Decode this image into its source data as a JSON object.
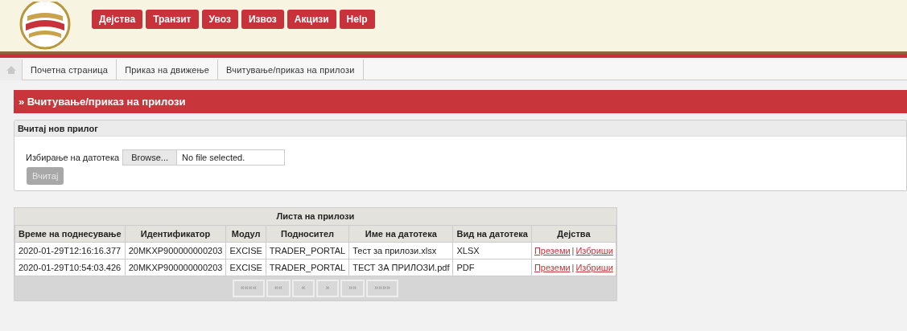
{
  "menu": [
    {
      "label": "Дејства"
    },
    {
      "label": "Транзит"
    },
    {
      "label": "Увоз"
    },
    {
      "label": "Извоз"
    },
    {
      "label": "Акцизи"
    },
    {
      "label": "Help"
    }
  ],
  "breadcrumb": [
    "Почетна страница",
    "Приказ на движење",
    "Вчитување/приказ на прилози"
  ],
  "page_title": "» Вчитување/приказ на прилози",
  "upload": {
    "title": "Вчитај нов прилог",
    "label": "Избирање на датотека",
    "browse_button": "Browse...",
    "file_status": "No file selected.",
    "submit_button": {
      "label": "Вчитај",
      "disabled": true
    }
  },
  "table": {
    "title": "Листа на прилози",
    "columns": [
      "Време на поднесување",
      "Идентификатор",
      "Модул",
      "Подносител",
      "Име на датотека",
      "Вид на датотека",
      "Дејства"
    ],
    "rows": [
      {
        "cells": [
          "2020-01-29T12:16:16.377",
          "20MKXP900000000203",
          "EXCISE",
          "TRADER_PORTAL",
          "Тест за прилози.xlsx",
          "XLSX"
        ],
        "links": [
          "Преземи",
          "Избриши"
        ]
      },
      {
        "cells": [
          "2020-01-29T10:54:03.426",
          "20MKXP900000000203",
          "EXCISE",
          "TRADER_PORTAL",
          "ТЕСТ ЗА ПРИЛОЗИ.pdf",
          "PDF"
        ],
        "links": [
          "Преземи",
          "Избриши"
        ]
      }
    ],
    "link_separator": "|",
    "pager": [
      {
        "label": "««««",
        "disabled": true
      },
      {
        "label": "««",
        "disabled": true
      },
      {
        "label": "«",
        "disabled": true
      },
      {
        "label": "»",
        "disabled": true
      },
      {
        "label": "»»",
        "disabled": true
      },
      {
        "label": "»»»»",
        "disabled": true
      }
    ]
  }
}
